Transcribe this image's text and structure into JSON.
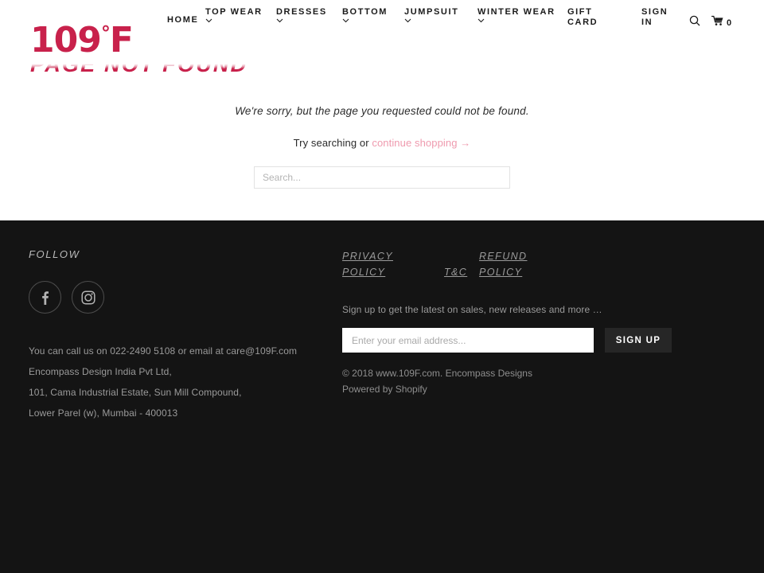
{
  "header": {
    "logo": {
      "main": "109",
      "degree": "°",
      "suffix": "F",
      "full": "109°F",
      "color": "#c8214b"
    },
    "nav": [
      {
        "label": "HOME",
        "has_dropdown": false
      },
      {
        "label": "TOP WEAR",
        "has_dropdown": true
      },
      {
        "label": "DRESSES",
        "has_dropdown": true
      },
      {
        "label": "BOTTOM",
        "has_dropdown": true
      },
      {
        "label": "JUMPSUIT",
        "has_dropdown": true
      },
      {
        "label": "WINTER WEAR",
        "has_dropdown": true
      },
      {
        "label": "GIFT CARD",
        "has_dropdown": false
      },
      {
        "label": "SIGN IN",
        "has_dropdown": false
      }
    ],
    "search_icon": "search-icon",
    "cart_icon": "cart-icon",
    "cart_count": "0"
  },
  "page": {
    "title": "PAGE NOT FOUND",
    "title_color": "#c8214b",
    "message": "We're sorry, but the page you requested could not be found.",
    "try_prefix": "Try searching or ",
    "continue_link": "continue shopping →",
    "continue_link_color": "#ef9aae",
    "search_placeholder": "Search...",
    "search_value": ""
  },
  "footer": {
    "background": "#141414",
    "follow_title": "FOLLOW",
    "social": [
      {
        "name": "facebook",
        "glyph": "f"
      },
      {
        "name": "instagram",
        "glyph": "instagram-icon"
      }
    ],
    "contact": [
      "You can call us on 022-2490 5108 or email at care@109F.com",
      "Encompass Design India Pvt Ltd,",
      "101, Cama Industrial Estate, Sun Mill Compound,",
      "Lower Parel (w), Mumbai - 400013"
    ],
    "links": {
      "privacy": "PRIVACY POLICY",
      "tc": "T&C",
      "refund": "REFUND POLICY"
    },
    "signup_note": "Sign up to get the latest on sales, new releases and more …",
    "email_placeholder": "Enter your email address...",
    "email_value": "",
    "signup_button": "SIGN UP",
    "copyright": "© 2018 www.109F.com. Encompass Designs",
    "powered_by": "Powered by Shopify"
  }
}
